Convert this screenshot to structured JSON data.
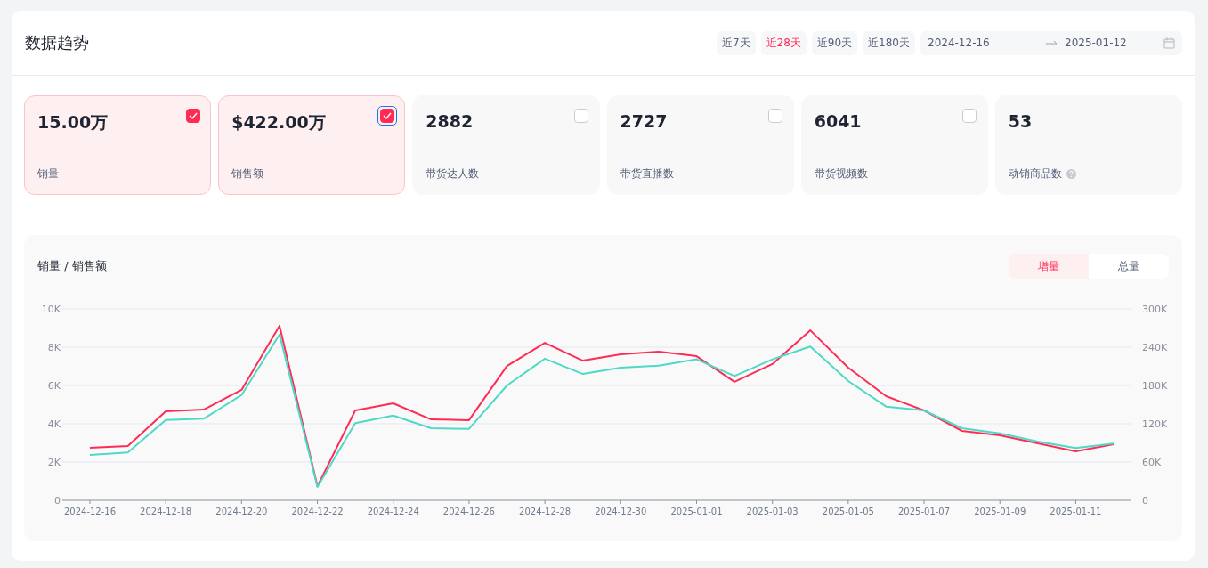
{
  "header": {
    "title": "数据趋势",
    "ranges": [
      {
        "label": "近7天",
        "selected": false
      },
      {
        "label": "近28天",
        "selected": true
      },
      {
        "label": "近90天",
        "selected": false
      },
      {
        "label": "近180天",
        "selected": false
      }
    ],
    "date_range": {
      "start": "2024-12-16",
      "end": "2025-01-12"
    }
  },
  "metrics": [
    {
      "kind": "checkbox",
      "value": "15.00万",
      "label": "销量",
      "checked": true,
      "focused": false
    },
    {
      "kind": "checkbox",
      "value": "$422.00万",
      "label": "销售额",
      "checked": true,
      "focused": true
    },
    {
      "kind": "checkbox",
      "value": "2882",
      "label": "带货达人数",
      "checked": false,
      "focused": false
    },
    {
      "kind": "checkbox",
      "value": "2727",
      "label": "带货直播数",
      "checked": false,
      "focused": false
    },
    {
      "kind": "checkbox",
      "value": "6041",
      "label": "带货视频数",
      "checked": false,
      "focused": false
    },
    {
      "kind": "help",
      "value": "53",
      "label": "动销商品数"
    }
  ],
  "trend": {
    "title": "销量 / 销售额",
    "modes": [
      {
        "label": "增量",
        "selected": true
      },
      {
        "label": "总量",
        "selected": false
      }
    ],
    "chart_data": {
      "type": "line",
      "categories": [
        "2024-12-16",
        null,
        "2024-12-18",
        null,
        "2024-12-20",
        null,
        "2024-12-22",
        null,
        "2024-12-24",
        null,
        "2024-12-26",
        null,
        "2024-12-28",
        null,
        "2024-12-30",
        null,
        "2025-01-01",
        null,
        "2025-01-03",
        null,
        "2025-01-05",
        null,
        "2025-01-07",
        null,
        "2025-01-09",
        null,
        "2025-01-11",
        null
      ],
      "series": [
        {
          "color": "#fe2c55",
          "values": [
            2740,
            2840,
            4650,
            4740,
            5770,
            9120,
            740,
            4700,
            5070,
            4230,
            4190,
            7020,
            8230,
            7300,
            7630,
            7770,
            7530,
            6190,
            7120,
            8880,
            6930,
            5440,
            4700,
            3630,
            3400,
            2980,
            2560,
            2930
          ]
        },
        {
          "color": "#4dd9c6",
          "axis": "y2",
          "values": [
            71000,
            75000,
            126000,
            128000,
            165000,
            260000,
            21000,
            121000,
            133000,
            113000,
            112000,
            180000,
            222000,
            198000,
            208000,
            211000,
            221000,
            195000,
            221000,
            241000,
            187000,
            147000,
            141000,
            113000,
            105000,
            92000,
            82000,
            89000
          ]
        }
      ],
      "grid": true,
      "ylim": [
        0,
        10000
      ],
      "yticks": [
        {
          "value": 0,
          "label": "0"
        },
        {
          "value": 2000,
          "label": "2K"
        },
        {
          "value": 4000,
          "label": "4K"
        },
        {
          "value": 6000,
          "label": "6K"
        },
        {
          "value": 8000,
          "label": "8K"
        },
        {
          "value": 10000,
          "label": "10K"
        }
      ],
      "y2lim": [
        0,
        300000
      ],
      "y2ticks": [
        {
          "value": 0,
          "label": "0"
        },
        {
          "value": 60000,
          "label": "60K"
        },
        {
          "value": 120000,
          "label": "120K"
        },
        {
          "value": 180000,
          "label": "180K"
        },
        {
          "value": 240000,
          "label": "240K"
        },
        {
          "value": 300000,
          "label": "300K"
        }
      ]
    }
  }
}
